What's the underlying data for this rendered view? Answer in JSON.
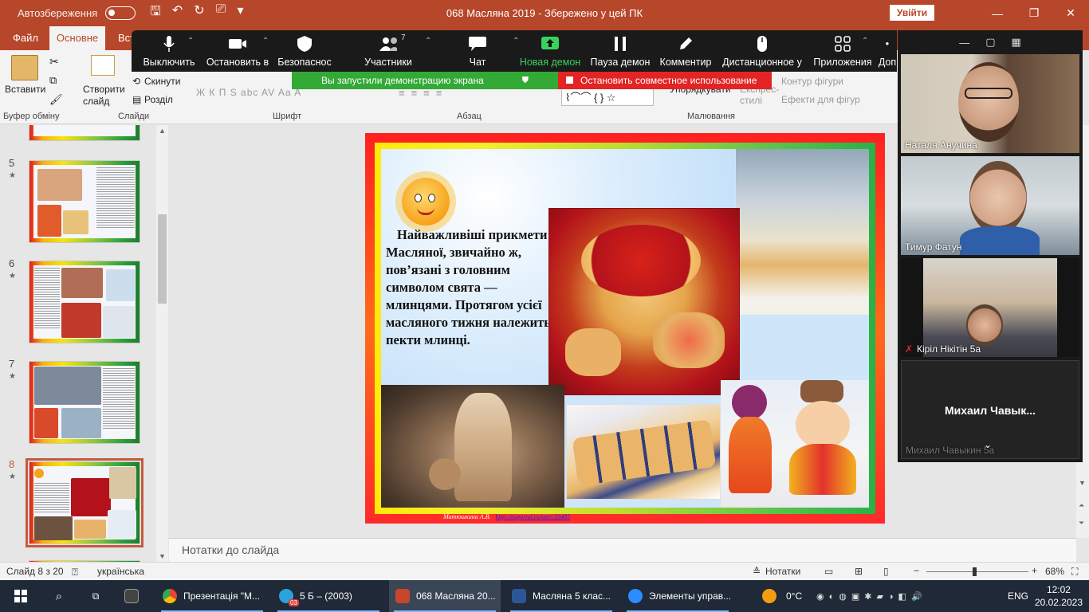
{
  "titlebar": {
    "autosave_label": "Автозбереження",
    "document_title": "068 Масляна 2019  -  Збережено у цей ПК",
    "signin_label": "Увійти",
    "minimize": "—",
    "restore": "❐",
    "close": "✕"
  },
  "tabs": {
    "file": "Файл",
    "home": "Основне",
    "insert_partial": "Вст"
  },
  "ribbon": {
    "paste": "Вставити",
    "clipboard_group": "Буфер обміну",
    "new_slide": "Створити слайд",
    "reset": "Скинути",
    "section": "Розділ",
    "slides_group": "Слайди",
    "font_group": "Шрифт",
    "paragraph_group": "Абзац",
    "drawing_group": "Малювання",
    "arrange": "Упорядкувати",
    "express_styles": "Експрес-стилі",
    "shape_outline": "Контур фігури",
    "shape_effects": "Ефекти для фігур",
    "font_buttons": "Ж  К  П  S  abc  AV  Aa  A"
  },
  "zoom_toolbar": {
    "mute": "Выключить",
    "stop_video": "Остановить в",
    "security": "Безопаснос",
    "participants": "Участники",
    "participants_count": "7",
    "chat": "Чат",
    "new_share": "Новая демон",
    "pause_share": "Пауза демон",
    "annotate": "Комментир",
    "remote_control": "Дистанционное у",
    "apps": "Приложения",
    "more_partial": "Доп",
    "share_banner": "Вы запустили демонстрацию экрана",
    "stop_share": "Остановить совместное использование"
  },
  "thumbnails": [
    {
      "number": "5",
      "star": "★"
    },
    {
      "number": "6",
      "star": "★"
    },
    {
      "number": "7",
      "star": "★"
    },
    {
      "number": "8",
      "star": "★"
    }
  ],
  "slide": {
    "text": "Найважливіші прикмети Масляної, звичайно ж, пов’язані з головним символом свята — млинцями. Протягом усієї масляного тижня належить пекти млинці.",
    "footer_author": "Матюшкина А.В.",
    "footer_link": "http://nsportal.ru/user/33485"
  },
  "notes": {
    "placeholder": "Нотатки до слайда"
  },
  "statusbar": {
    "slide_info": "Слайд 8 з 20",
    "language": "українська",
    "notes_button": "Нотатки",
    "zoom_level": "68%"
  },
  "participants": [
    {
      "name": "Наталя Анучина"
    },
    {
      "name": "Тимур Фатун"
    },
    {
      "name": "Кірiл Нікітін 5а",
      "muted": true
    },
    {
      "name": "Михаил Чавыкин 5а",
      "display_name": "Михаил  Чавык..."
    }
  ],
  "taskbar": {
    "chrome": "Презентація \"М...",
    "telegram": "5 Б – (2003)",
    "telegram_badge": "03",
    "powerpoint": "068 Масляна 20...",
    "word": "Масляна 5 клас...",
    "zoom": "Элементы управ...",
    "temperature": "0°C",
    "lang": "ENG",
    "time": "12:02",
    "date": "20.02.2023"
  },
  "colors": {
    "powerpoint_accent": "#b7472a",
    "zoom_bar": "#1a1a1a",
    "share_green": "#33a936",
    "stop_red": "#e32424"
  }
}
